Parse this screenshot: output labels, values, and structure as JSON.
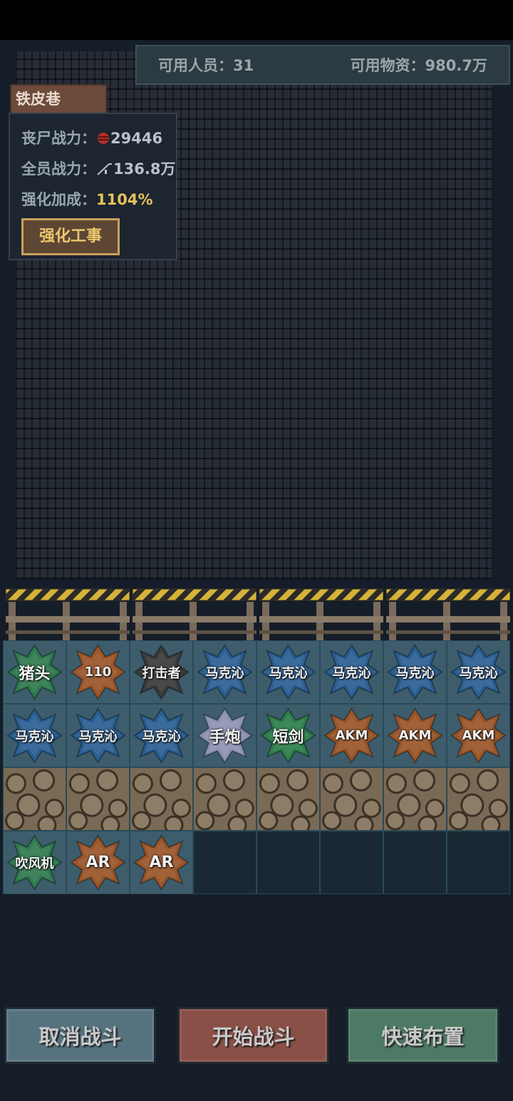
{
  "resources": {
    "staff_label": "可用人员：31",
    "supplies_label": "可用物资：980.7万"
  },
  "location": {
    "name": "铁皮巷"
  },
  "stats": {
    "zombie_power_label": "丧尸战力：",
    "zombie_power_value": "29446",
    "team_power_label": "全员战力：",
    "team_power_value": "136.8万",
    "bonus_label": "强化加成：",
    "bonus_value": "1104%",
    "fortify_button": "强化工事"
  },
  "units": [
    {
      "label": "猪头",
      "color": "#2f7a4e"
    },
    {
      "label": "110",
      "color": "#9a5529"
    },
    {
      "label": "打击者",
      "color": "#3a3a3a"
    },
    {
      "label": "马克沁",
      "color": "#2b5f93"
    },
    {
      "label": "马克沁",
      "color": "#2b5f93"
    },
    {
      "label": "马克沁",
      "color": "#2b5f93"
    },
    {
      "label": "马克沁",
      "color": "#2b5f93"
    },
    {
      "label": "马克沁",
      "color": "#2b5f93"
    },
    {
      "label": "马克沁",
      "color": "#2b5f93"
    },
    {
      "label": "马克沁",
      "color": "#2b5f93"
    },
    {
      "label": "马克沁",
      "color": "#2b5f93"
    },
    {
      "label": "手炮",
      "color": "#8e93b4"
    },
    {
      "label": "短剑",
      "color": "#2d7e4a"
    },
    {
      "label": "AKM",
      "color": "#9a5529"
    },
    {
      "label": "AKM",
      "color": "#9a5529"
    },
    {
      "label": "AKM",
      "color": "#9a5529"
    },
    {
      "label": "吹风机",
      "color": "#2f7a4e"
    },
    {
      "label": "AR",
      "color": "#9a5529"
    },
    {
      "label": "AR",
      "color": "#9a5529"
    }
  ],
  "buttons": {
    "cancel": "取消战斗",
    "start": "开始战斗",
    "quick": "快速布置"
  },
  "colors": {
    "cancel": "#56727f",
    "start": "#8a4f47",
    "quick": "#4d7a65",
    "gold": "#e6c25a"
  }
}
